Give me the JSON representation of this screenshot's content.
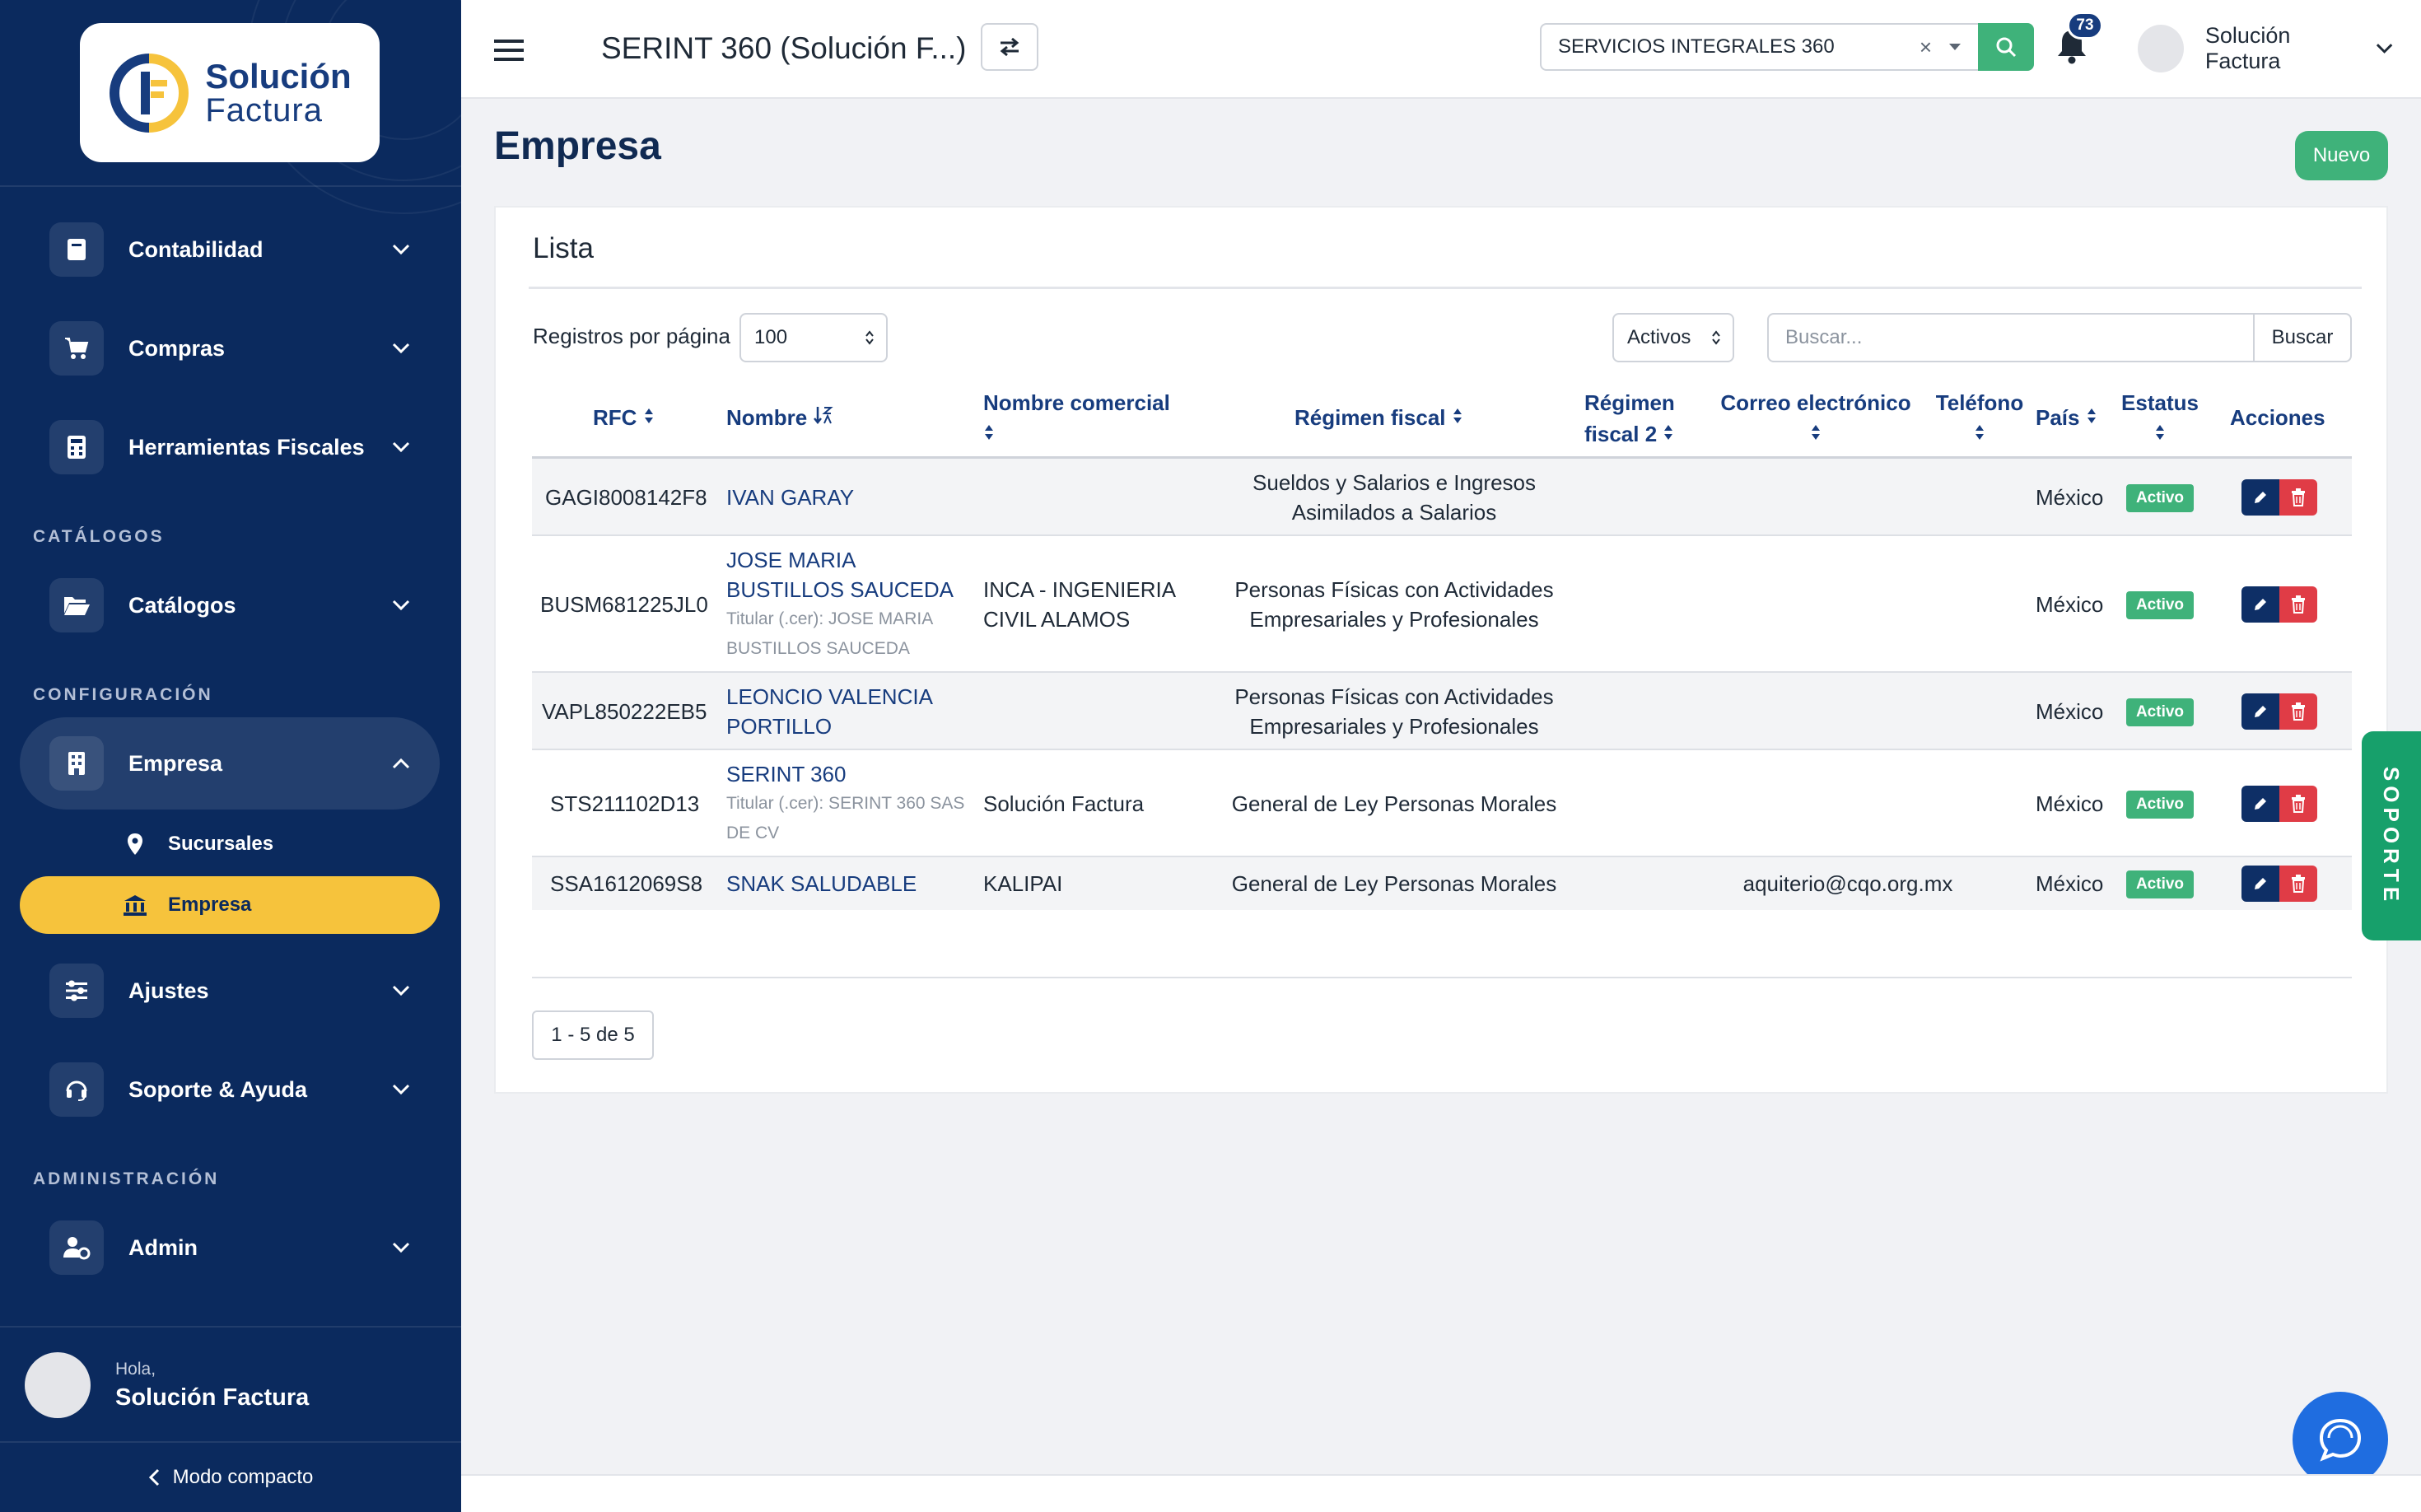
{
  "sidebar": {
    "logo": {
      "line1": "Solución",
      "line2": "Factura"
    },
    "nav": {
      "contabilidad": "Contabilidad",
      "compras": "Compras",
      "herramientas": "Herramientas Fiscales",
      "catalogos": "Catálogos",
      "empresa": "Empresa",
      "ajustes": "Ajustes",
      "soporte": "Soporte & Ayuda",
      "admin": "Admin"
    },
    "sections": {
      "catalogos": "CATÁLOGOS",
      "configuracion": "CONFIGURACIÓN",
      "administracion": "ADMINISTRACIÓN"
    },
    "submenu": {
      "sucursales": "Sucursales",
      "empresa": "Empresa"
    },
    "user": {
      "greeting": "Hola,",
      "name": "Solución Factura"
    },
    "compact_label": "Modo compacto"
  },
  "topbar": {
    "title": "SERINT 360 (Solución F...)",
    "company_select": "SERVICIOS INTEGRALES 360",
    "clear_glyph": "×",
    "notifications_count": "73",
    "user_name": "Solución Factura"
  },
  "page": {
    "title": "Empresa",
    "new_button": "Nuevo"
  },
  "card": {
    "title": "Lista",
    "per_page_label": "Registros por página",
    "per_page_value": "100",
    "status_filter": "Activos",
    "search_placeholder": "Buscar...",
    "search_button": "Buscar",
    "pagination": "1 - 5 de 5"
  },
  "table": {
    "headers": {
      "rfc": "RFC",
      "nombre": "Nombre",
      "nombre_comercial": "Nombre comercial",
      "regimen_fiscal": "Régimen fiscal",
      "regimen_fiscal_2_a": "Régimen",
      "regimen_fiscal_2_b": "fiscal 2",
      "correo": "Correo electrónico",
      "telefono": "Teléfono",
      "pais": "País",
      "estatus": "Estatus",
      "acciones": "Acciones"
    },
    "rows": [
      {
        "rfc": "GAGI8008142F8",
        "nombre": "IVAN GARAY",
        "titular": "",
        "nombre_comercial": "",
        "regimen": "Sueldos y Salarios e Ingresos Asimilados a Salarios",
        "correo": "",
        "pais": "México",
        "estatus": "Activo"
      },
      {
        "rfc": "BUSM681225JL0",
        "nombre": "JOSE MARIA BUSTILLOS SAUCEDA",
        "titular": "Titular (.cer): JOSE MARIA BUSTILLOS SAUCEDA",
        "nombre_comercial": "INCA - INGENIERIA CIVIL ALAMOS",
        "regimen": "Personas Físicas con Actividades Empresariales y Profesionales",
        "correo": "",
        "pais": "México",
        "estatus": "Activo"
      },
      {
        "rfc": "VAPL850222EB5",
        "nombre": "LEONCIO VALENCIA PORTILLO",
        "titular": "",
        "nombre_comercial": "",
        "regimen": "Personas Físicas con Actividades Empresariales y Profesionales",
        "correo": "",
        "pais": "México",
        "estatus": "Activo"
      },
      {
        "rfc": "STS211102D13",
        "nombre": "SERINT 360",
        "titular": "Titular (.cer): SERINT 360 SAS DE CV",
        "nombre_comercial": "Solución Factura",
        "regimen": "General de Ley Personas Morales",
        "correo": "",
        "pais": "México",
        "estatus": "Activo"
      },
      {
        "rfc": "SSA1612069S8",
        "nombre": "SNAK SALUDABLE",
        "titular": "",
        "nombre_comercial": "KALIPAI",
        "regimen": "General de Ley Personas Morales",
        "correo": "aquiterio@cqo.org.mx",
        "pais": "México",
        "estatus": "Activo"
      }
    ]
  },
  "floating": {
    "soporte": "SOPORTE"
  },
  "colors": {
    "sidebar": "#0b2a5e",
    "accent_yellow": "#f6c33c",
    "success": "#3fb27a",
    "danger": "#e03c46",
    "link": "#173c7e"
  }
}
